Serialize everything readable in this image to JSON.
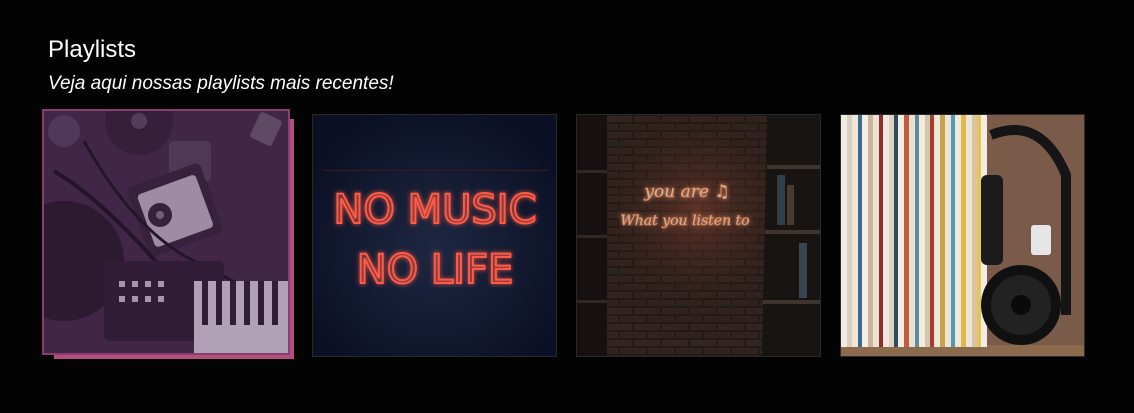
{
  "section": {
    "title": "Playlists",
    "subtitle": "Veja aqui nossas playlists mais recentes!"
  },
  "playlists": [
    {
      "name": "studio-gear",
      "active": true,
      "accent": "#b24f7e"
    },
    {
      "name": "no-music-no-life",
      "neon_line1": "NO MUSIC",
      "neon_line2": "NO LIFE",
      "neon_color": "#ff5a45"
    },
    {
      "name": "brick-wall-neon",
      "neon_line1": "you are ♫",
      "neon_line2": "What you listen to",
      "neon_color": "#ffb38a"
    },
    {
      "name": "vinyl-records"
    }
  ],
  "colors": {
    "background": "#040304",
    "hover_accent": "#b24f7e"
  }
}
